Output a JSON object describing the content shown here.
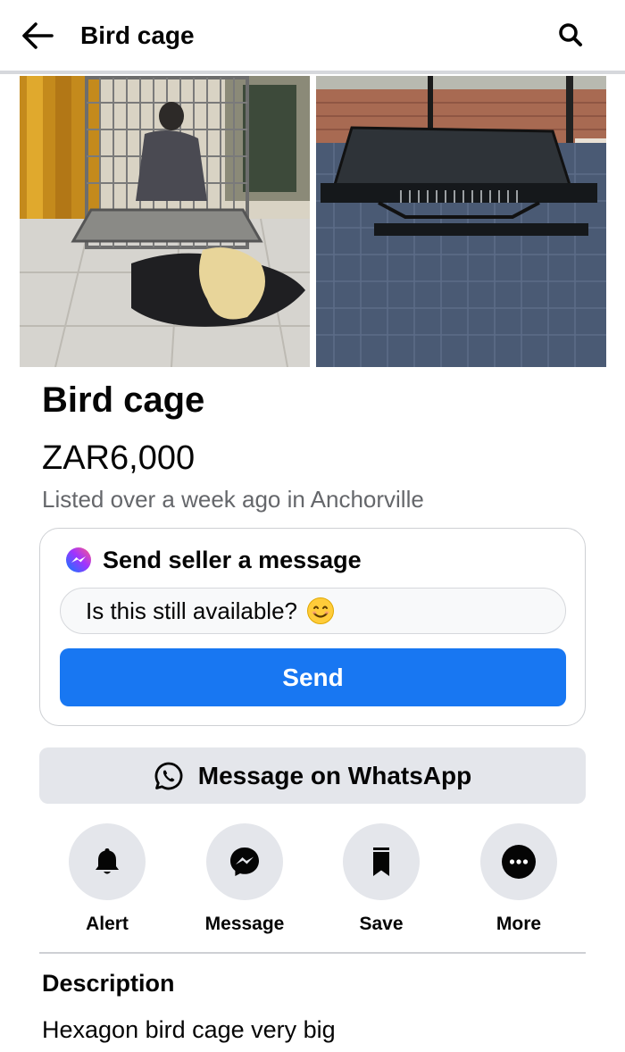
{
  "header": {
    "back_icon": "arrow-left-icon",
    "title": "Bird cage",
    "search_icon": "search-icon"
  },
  "photos": [
    {
      "name": "bird-cage-photo-1"
    },
    {
      "name": "bird-cage-photo-2"
    }
  ],
  "listing": {
    "title": "Bird cage",
    "price": "ZAR6,000",
    "listed": "Listed over a week ago in Anchorville"
  },
  "message_card": {
    "heading": "Send seller a message",
    "icon": "messenger-icon",
    "input_value": "Is this still available?",
    "emoji": "smiling-face-emoji",
    "send_label": "Send"
  },
  "whatsapp": {
    "label": "Message on WhatsApp",
    "icon": "whatsapp-icon"
  },
  "actions": [
    {
      "label": "Alert",
      "icon": "bell-icon"
    },
    {
      "label": "Message",
      "icon": "messenger-icon"
    },
    {
      "label": "Save",
      "icon": "bookmark-icon"
    },
    {
      "label": "More",
      "icon": "more-dots-icon"
    }
  ],
  "description": {
    "heading": "Description",
    "body": "Hexagon bird cage very big"
  },
  "colors": {
    "accent": "#1877f2",
    "secondary_bg": "#e4e6eb",
    "muted_text": "#65676b"
  }
}
